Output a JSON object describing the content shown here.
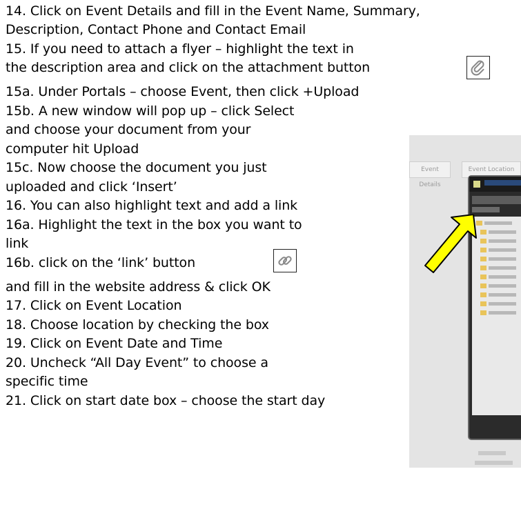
{
  "instructions": [
    "14. Click on Event Details and fill in the Event Name, Summary,",
    "Description, Contact Phone and Contact Email",
    "15. If you need to attach a flyer – highlight the text in",
    "the description area and click on the attachment button",
    "15a. Under Portals – choose Event, then click +Upload",
    "15b. A new window will pop up – click Select",
    "and choose your document from your",
    "computer hit Upload",
    "15c. Now choose the document you just",
    "uploaded and  click ‘Insert’",
    "16. You can also highlight text and add a link",
    "16a. Highlight the text in the box you want to",
    "link",
    "16b. click on the ‘link’ button",
    "and fill in the website address & click OK",
    "17. Click on Event Location",
    "18.  Choose location by checking the box",
    "19.  Click on Event Date and Time",
    "20.  Uncheck “All Day Event” to choose a",
    "specific time",
    "21. Click on start date box – choose the start day"
  ],
  "icons": {
    "attachment": "paperclip-icon",
    "link": "chain-link-icon",
    "arrow_color": "#ffff00"
  },
  "screenshot": {
    "tabs": [
      "Event Details",
      "Event Location"
    ],
    "tree_items": 11,
    "folder_color": "#e9c45a"
  }
}
